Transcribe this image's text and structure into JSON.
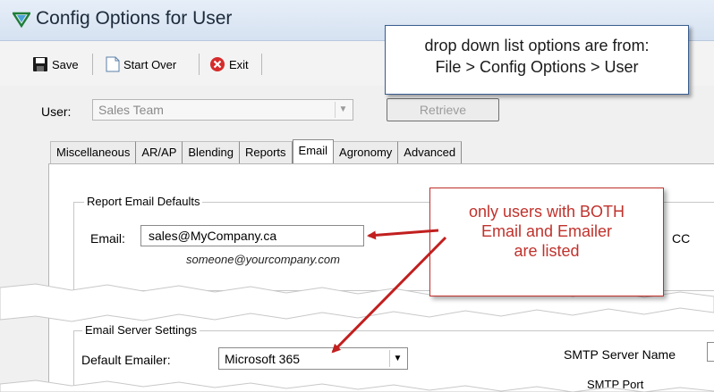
{
  "window": {
    "title": "Config Options for User"
  },
  "toolbar": {
    "save_label": "Save",
    "start_over_label": "Start Over",
    "exit_label": "Exit"
  },
  "user_row": {
    "label": "User:",
    "value": "Sales Team",
    "retrieve_label": "Retrieve"
  },
  "tabs": [
    {
      "label": "Miscellaneous",
      "active": false
    },
    {
      "label": "AR/AP",
      "active": false
    },
    {
      "label": "Blending",
      "active": false
    },
    {
      "label": "Reports",
      "active": false
    },
    {
      "label": "Email",
      "active": true
    },
    {
      "label": "Agronomy",
      "active": false
    },
    {
      "label": "Advanced",
      "active": false
    }
  ],
  "report_email_defaults": {
    "title": "Report Email Defaults",
    "email_label": "Email:",
    "email_value": "sales@MyCompany.ca",
    "email_hint": "someone@yourcompany.com",
    "cc_label": "CC"
  },
  "email_server_settings": {
    "title": "Email Server Settings",
    "default_emailer_label": "Default Emailer:",
    "default_emailer_value": "Microsoft 365",
    "smtp_server_name_label": "SMTP Server Name",
    "smtp_port_label": "SMTP Port"
  },
  "callouts": {
    "blue_line1": "drop down list options are from:",
    "blue_line2": "File > Config Options > User",
    "red_line1": "only users with BOTH",
    "red_line2": "Email and Emailer",
    "red_line3": "are listed"
  },
  "colors": {
    "callout_red": "#c0322c",
    "callout_blue_border": "#395d8f",
    "arrow_red": "#c21f1f"
  }
}
